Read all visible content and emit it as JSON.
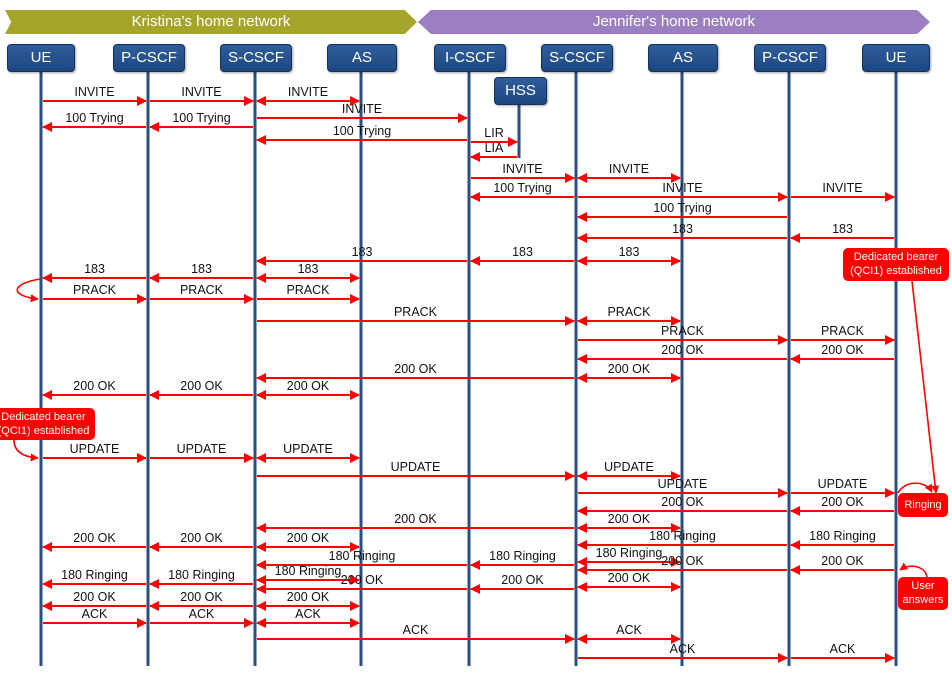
{
  "networks": {
    "left": "Kristina's home network",
    "right": "Jennifer's home network"
  },
  "nodes": [
    "UE",
    "P-CSCF",
    "S-CSCF",
    "AS",
    "I-CSCF",
    "S-CSCF",
    "AS",
    "P-CSCF",
    "UE"
  ],
  "hss": "HSS",
  "colors": {
    "arrow": "#ff0000",
    "lifeline": "#2b4f80",
    "node": "#24508a",
    "left_network": "#a4a52a",
    "right_network": "#9b7fc1",
    "note": "#ff0000"
  },
  "notes": {
    "bearer_right": "Dedicated bearer (QCI1) established",
    "bearer_left": "Dedicated bearer (QCI1) established",
    "ringing": "Ringing",
    "user_answers": "User answers"
  },
  "rows": [
    [
      [
        "INVITE",
        0,
        1,
        "end"
      ],
      [
        "INVITE",
        1,
        2,
        "end"
      ],
      [
        "INVITE",
        2,
        3,
        "both"
      ]
    ],
    [
      [
        "INVITE",
        2,
        4,
        "end"
      ]
    ],
    [
      [
        "100 Trying",
        1,
        0,
        "end"
      ],
      [
        "100 Trying",
        2,
        1,
        "end"
      ]
    ],
    [
      [
        "100 Trying",
        4,
        2,
        "end"
      ]
    ],
    [
      [
        "LIR",
        4,
        9,
        "end"
      ]
    ],
    [
      [
        "LIA",
        9,
        4,
        "end"
      ]
    ],
    [
      [
        "INVITE",
        4,
        5,
        "end"
      ],
      [
        "INVITE",
        5,
        6,
        "both"
      ]
    ],
    [
      [
        "100 Trying",
        5,
        4,
        "end"
      ],
      [
        "INVITE",
        5,
        7,
        "end"
      ],
      [
        "INVITE",
        7,
        8,
        "end"
      ]
    ],
    [
      [
        "100 Trying",
        7,
        5,
        "end"
      ]
    ],
    [
      [
        "183",
        8,
        7,
        "end"
      ],
      [
        "183",
        7,
        5,
        "end"
      ]
    ],
    [
      [
        "183",
        4,
        2,
        "end"
      ],
      [
        "183",
        5,
        4,
        "end"
      ],
      [
        "183",
        5,
        6,
        "both"
      ]
    ],
    [
      [
        "183",
        1,
        0,
        "end"
      ],
      [
        "183",
        2,
        1,
        "end"
      ],
      [
        "183",
        2,
        3,
        "both"
      ]
    ],
    [
      [
        "PRACK",
        0,
        1,
        "end"
      ],
      [
        "PRACK",
        1,
        2,
        "end"
      ],
      [
        "PRACK",
        2,
        3,
        "end"
      ]
    ],
    [
      [
        "PRACK",
        2,
        5,
        "end"
      ],
      [
        "PRACK",
        5,
        6,
        "both"
      ]
    ],
    [
      [
        "PRACK",
        5,
        7,
        "end"
      ],
      [
        "PRACK",
        7,
        8,
        "end"
      ]
    ],
    [
      [
        "200 OK",
        7,
        5,
        "end"
      ],
      [
        "200 OK",
        8,
        7,
        "end"
      ]
    ],
    [
      [
        "200 OK",
        5,
        2,
        "end"
      ],
      [
        "200 OK",
        5,
        6,
        "both"
      ]
    ],
    [
      [
        "200 OK",
        1,
        0,
        "end"
      ],
      [
        "200 OK",
        2,
        1,
        "end"
      ],
      [
        "200 OK",
        2,
        3,
        "both"
      ]
    ],
    [
      [
        "UPDATE",
        0,
        1,
        "end"
      ],
      [
        "UPDATE",
        1,
        2,
        "end"
      ],
      [
        "UPDATE",
        2,
        3,
        "both"
      ]
    ],
    [
      [
        "UPDATE",
        2,
        5,
        "end"
      ],
      [
        "UPDATE",
        5,
        6,
        "both"
      ]
    ],
    [
      [
        "UPDATE",
        5,
        7,
        "end"
      ],
      [
        "UPDATE",
        7,
        8,
        "end"
      ]
    ],
    [
      [
        "200 OK",
        7,
        5,
        "end"
      ],
      [
        "200 OK",
        8,
        7,
        "end"
      ]
    ],
    [
      [
        "200 OK",
        5,
        2,
        "end"
      ],
      [
        "200 OK",
        5,
        6,
        "both"
      ]
    ],
    [
      [
        "200 OK",
        1,
        0,
        "end"
      ],
      [
        "200 OK",
        2,
        1,
        "end"
      ],
      [
        "200 OK",
        2,
        3,
        "both"
      ]
    ],
    [
      [
        "180 Ringing",
        7,
        5,
        "end"
      ],
      [
        "180 Ringing",
        8,
        7,
        "end"
      ]
    ],
    [
      [
        "180 Ringing",
        4,
        2,
        "end"
      ],
      [
        "180 Ringing",
        5,
        4,
        "end"
      ]
    ],
    [
      [
        "180 Ringing",
        5,
        6,
        "both"
      ]
    ],
    [
      [
        "180 Ringing",
        1,
        0,
        "end"
      ],
      [
        "180 Ringing",
        2,
        1,
        "end"
      ]
    ],
    [
      [
        "180 Ringing",
        2,
        3,
        "both"
      ]
    ],
    [
      [
        "200 OK",
        7,
        5,
        "end"
      ],
      [
        "200 OK",
        8,
        7,
        "end"
      ]
    ],
    [
      [
        "200 OK",
        4,
        2,
        "end"
      ],
      [
        "200 OK",
        5,
        4,
        "end"
      ]
    ],
    [
      [
        "200 OK",
        5,
        6,
        "both"
      ]
    ],
    [
      [
        "200 OK",
        1,
        0,
        "end"
      ],
      [
        "200 OK",
        2,
        1,
        "end"
      ],
      [
        "200 OK",
        2,
        3,
        "both"
      ]
    ],
    [
      [
        "ACK",
        0,
        1,
        "end"
      ],
      [
        "ACK",
        1,
        2,
        "end"
      ],
      [
        "ACK",
        2,
        3,
        "both"
      ]
    ],
    [
      [
        "ACK",
        2,
        5,
        "end"
      ],
      [
        "ACK",
        5,
        6,
        "both"
      ]
    ],
    [
      [
        "ACK",
        5,
        7,
        "end"
      ],
      [
        "ACK",
        7,
        8,
        "end"
      ]
    ]
  ]
}
